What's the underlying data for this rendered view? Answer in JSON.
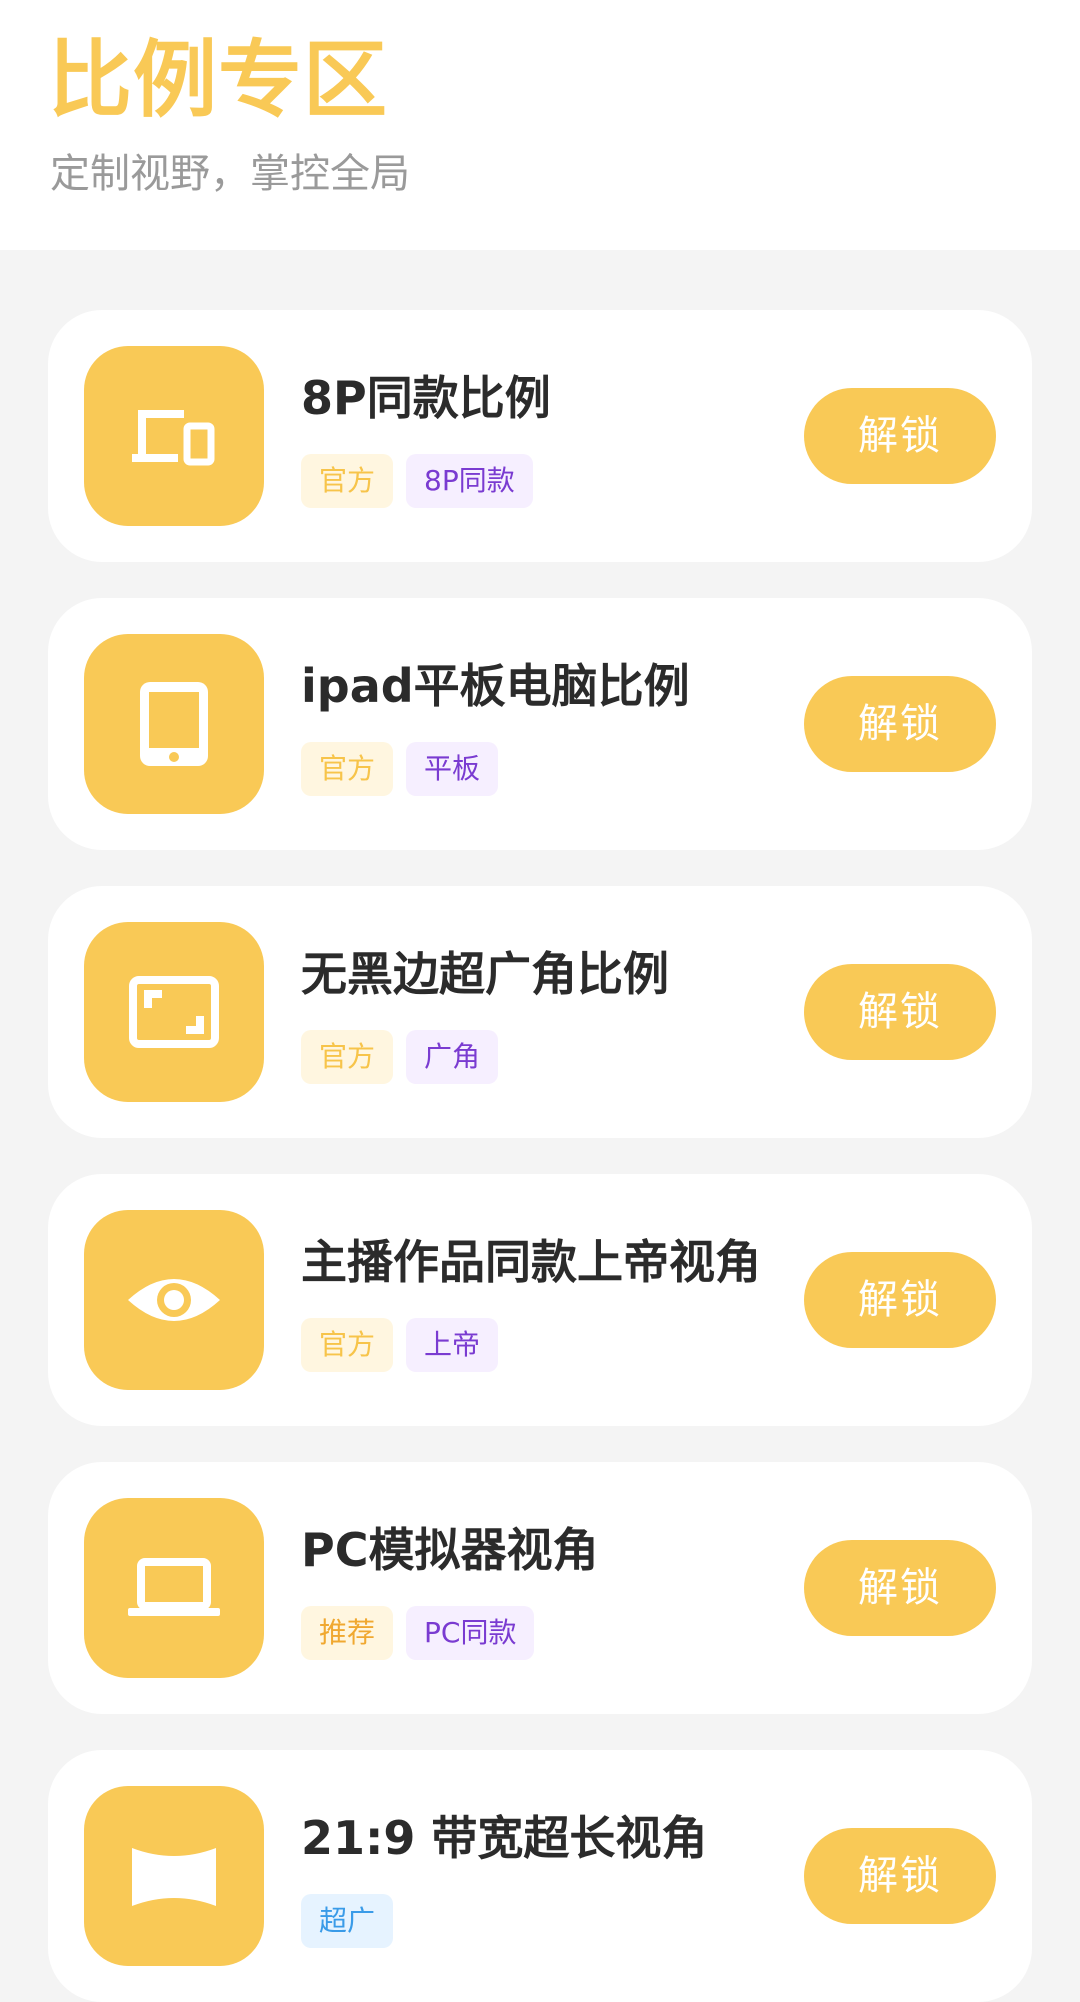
{
  "header": {
    "title": "比例专区",
    "subtitle": "定制视野，掌控全局"
  },
  "colors": {
    "accent": "#f9c956",
    "tag_purple_text": "#7a3bd1",
    "tag_blue_text": "#3a9be8"
  },
  "items": [
    {
      "title": "8P同款比例",
      "icon": "devices-icon",
      "tags": [
        {
          "label": "官方",
          "style": "official"
        },
        {
          "label": "8P同款",
          "style": "purple"
        }
      ],
      "button": "解锁"
    },
    {
      "title": "ipad平板电脑比例",
      "icon": "tablet-icon",
      "tags": [
        {
          "label": "官方",
          "style": "official"
        },
        {
          "label": "平板",
          "style": "purple"
        }
      ],
      "button": "解锁"
    },
    {
      "title": "无黑边超广角比例",
      "icon": "aspect-ratio-icon",
      "tags": [
        {
          "label": "官方",
          "style": "official"
        },
        {
          "label": "广角",
          "style": "purple"
        }
      ],
      "button": "解锁"
    },
    {
      "title": "主播作品同款上帝视角",
      "icon": "eye-icon",
      "tags": [
        {
          "label": "官方",
          "style": "official"
        },
        {
          "label": "上帝",
          "style": "purple"
        }
      ],
      "button": "解锁"
    },
    {
      "title": "PC模拟器视角",
      "icon": "laptop-icon",
      "tags": [
        {
          "label": "推荐",
          "style": "recommend"
        },
        {
          "label": "PC同款",
          "style": "purple"
        }
      ],
      "button": "解锁"
    },
    {
      "title": "21:9 带宽超长视角",
      "icon": "panorama-icon",
      "tags": [
        {
          "label": "超广",
          "style": "blue"
        }
      ],
      "button": "解锁"
    }
  ]
}
